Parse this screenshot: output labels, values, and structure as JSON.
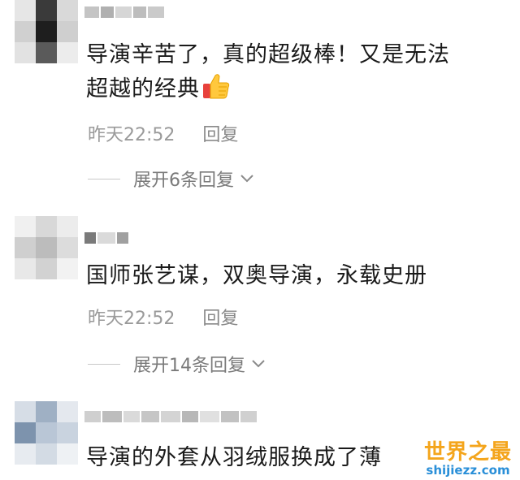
{
  "comments": [
    {
      "text_line1": "导演辛苦了，真的超级棒！又是无法",
      "text_line2": "超越的经典",
      "emoji": "thumbs-up-icon",
      "time": "昨天22:52",
      "reply_label": "回复",
      "expand_label": "展开6条回复"
    },
    {
      "text_line1": "国师张艺谋，双奥导演，永载史册",
      "time": "昨天22:52",
      "reply_label": "回复",
      "expand_label": "展开14条回复"
    },
    {
      "text_line1": "导演的外套从羽绒服换成了薄"
    }
  ],
  "watermark": {
    "title": "世界之最",
    "url": "shijiezz.com"
  },
  "colors": {
    "text": "#1a1a1a",
    "meta": "#9a9a9a",
    "watermark_title": "#f4a51c",
    "watermark_url": "#2a8fd8"
  }
}
